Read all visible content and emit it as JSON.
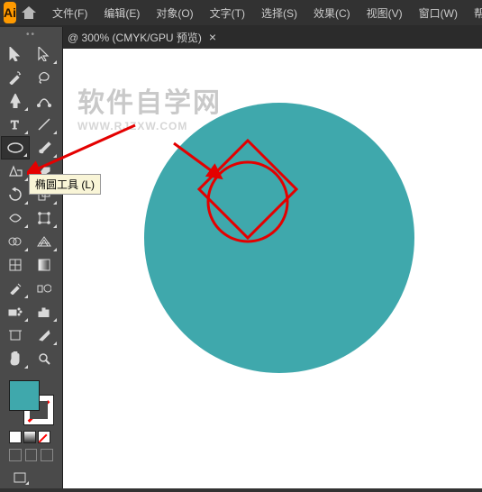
{
  "menu": {
    "file": "文件(F)",
    "edit": "编辑(E)",
    "object": "对象(O)",
    "type": "文字(T)",
    "select": "选择(S)",
    "effect": "效果(C)",
    "view": "视图(V)",
    "window": "窗口(W)",
    "help": "帮"
  },
  "doc": {
    "title": "@ 300% (CMYK/GPU 预览)",
    "close": "×"
  },
  "tooltip": "椭圆工具 (L)",
  "watermark": {
    "main": "软件自学网",
    "sub": "WWW.RJZXW.COM"
  },
  "colors": {
    "accent": "#3fa8ac",
    "shape_stroke": "#e40000"
  }
}
